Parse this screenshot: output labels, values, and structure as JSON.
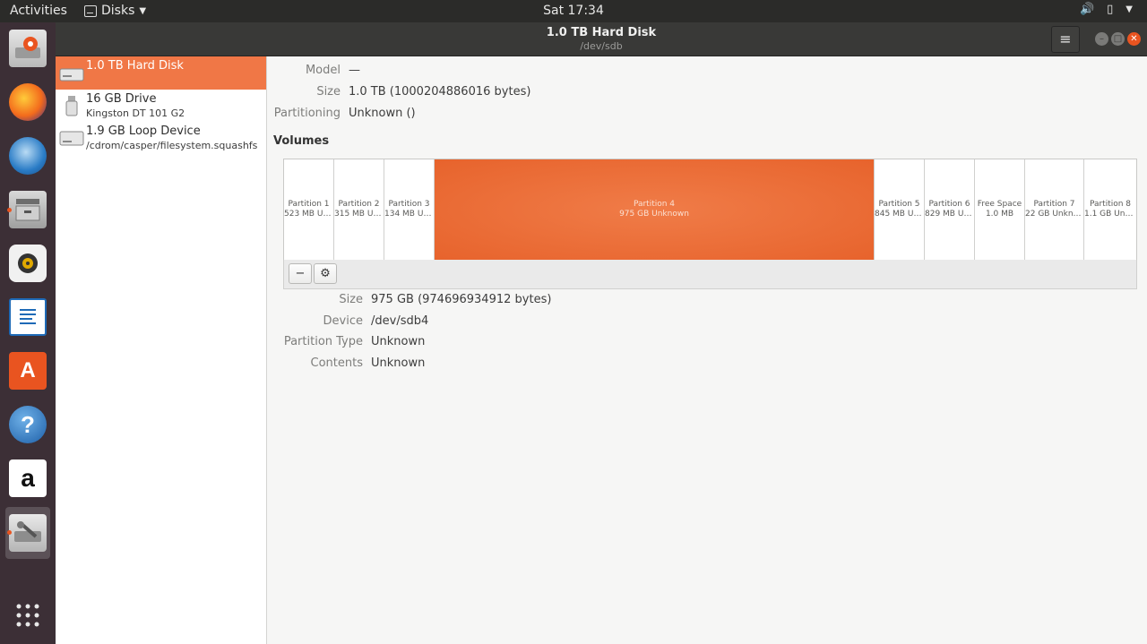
{
  "topbar": {
    "activities": "Activities",
    "app_name": "Disks",
    "clock": "Sat 17:34"
  },
  "window": {
    "title": "1.0 TB Hard Disk",
    "subtitle": "/dev/sdb"
  },
  "drives": [
    {
      "name": "1.0 TB Hard Disk",
      "sub": ""
    },
    {
      "name": "16 GB Drive",
      "sub": "Kingston DT 101 G2"
    },
    {
      "name": "1.9 GB Loop Device",
      "sub": "/cdrom/casper/filesystem.squashfs"
    }
  ],
  "disk_info": {
    "model_label": "Model",
    "model_value": "—",
    "size_label": "Size",
    "size_value": "1.0 TB (1000204886016 bytes)",
    "partitioning_label": "Partitioning",
    "partitioning_value": "Unknown ()"
  },
  "volumes_heading": "Volumes",
  "volumes": [
    {
      "name": "Partition 1",
      "info": "523 MB Un..."
    },
    {
      "name": "Partition 2",
      "info": "315 MB Un..."
    },
    {
      "name": "Partition 3",
      "info": "134 MB Un..."
    },
    {
      "name": "Partition 4",
      "info": "975 GB Unknown"
    },
    {
      "name": "Partition 5",
      "info": "845 MB Un..."
    },
    {
      "name": "Partition 6",
      "info": "829 MB Un..."
    },
    {
      "name": "Free Space",
      "info": "1.0 MB"
    },
    {
      "name": "Partition 7",
      "info": "22 GB Unkno..."
    },
    {
      "name": "Partition 8",
      "info": "1.1 GB Unk..."
    }
  ],
  "volume_tools": {
    "remove": "−",
    "settings": "⚙"
  },
  "volume_info": {
    "size_label": "Size",
    "size_value": "975 GB (974696934912 bytes)",
    "device_label": "Device",
    "device_value": "/dev/sdb4",
    "ptype_label": "Partition Type",
    "ptype_value": "Unknown",
    "contents_label": "Contents",
    "contents_value": "Unknown"
  },
  "dock_icons": [
    "disks-installer-icon",
    "firefox-icon",
    "thunderbird-icon",
    "files-icon",
    "rhythmbox-icon",
    "writer-icon",
    "software-icon",
    "help-icon",
    "amazon-icon",
    "disks-icon",
    "show-apps-icon"
  ],
  "colors": {
    "accent": "#e95420",
    "selected": "#f07746"
  }
}
